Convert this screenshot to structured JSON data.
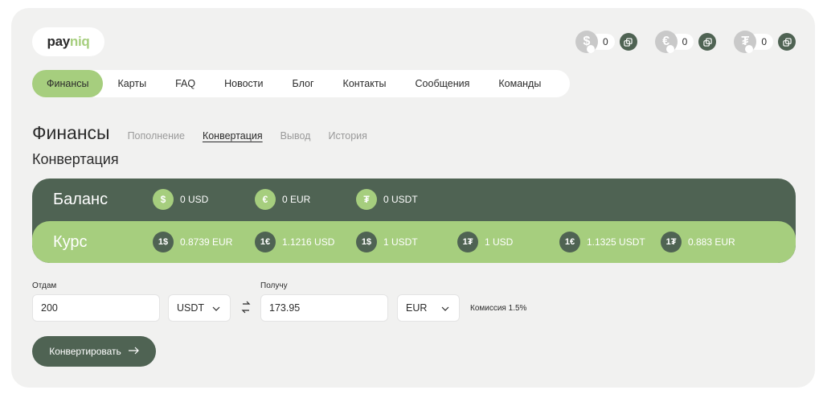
{
  "logo": {
    "part1": "pay",
    "part2": "niq"
  },
  "wallets": [
    {
      "icon": "dollar-icon",
      "glyph": "$",
      "value": "0"
    },
    {
      "icon": "euro-icon",
      "glyph": "€",
      "value": "0"
    },
    {
      "icon": "tether-icon",
      "glyph": "₮",
      "value": "0"
    }
  ],
  "nav": [
    "Финансы",
    "Карты",
    "FAQ",
    "Новости",
    "Блог",
    "Контакты",
    "Сообщения",
    "Команды"
  ],
  "page": {
    "title": "Финансы",
    "subtabs": [
      "Пополнение",
      "Конвертация",
      "Вывод",
      "История"
    ],
    "section_title": "Конвертация"
  },
  "balance": {
    "label": "Баланс",
    "items": [
      {
        "glyph": "$",
        "text": "0 USD"
      },
      {
        "glyph": "€",
        "text": "0 EUR"
      },
      {
        "glyph": "₮",
        "text": "0 USDT"
      }
    ]
  },
  "rates": {
    "label": "Курс",
    "items": [
      {
        "glyph": "1$",
        "text": "0.8739 EUR"
      },
      {
        "glyph": "1€",
        "text": "1.1216 USD"
      },
      {
        "glyph": "1$",
        "text": "1 USDT"
      },
      {
        "glyph": "1₮",
        "text": "1 USD"
      },
      {
        "glyph": "1€",
        "text": "1.1325 USDT"
      },
      {
        "glyph": "1₮",
        "text": "0.883 EUR"
      }
    ]
  },
  "form": {
    "give_label": "Отдам",
    "give_value": "200",
    "give_currency": "USDT",
    "get_label": "Получу",
    "get_value": "173.95",
    "get_currency": "EUR",
    "fee": "Комиссия 1.5%",
    "submit": "Конвертировать"
  },
  "colors": {
    "dark": "#4f6353",
    "accent": "#a6ce7e",
    "bg": "#f1f1f0"
  }
}
